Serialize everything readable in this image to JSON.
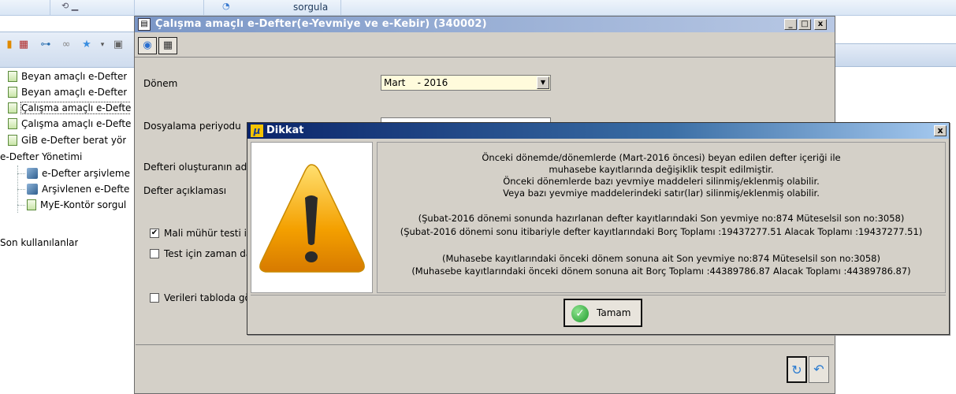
{
  "ribbon": {
    "sorgula_label": "sorgula"
  },
  "tree": {
    "items": [
      {
        "label": "Beyan amaçlı e-Defter"
      },
      {
        "label": "Beyan amaçlı e-Defter"
      },
      {
        "label": "Çalışma amaçlı e-Defte"
      },
      {
        "label": "Çalışma amaçlı e-Defte"
      },
      {
        "label": "GİB e-Defter berat yör"
      },
      {
        "label": "e-Defter Yönetimi"
      },
      {
        "label": "e-Defter arşivleme"
      },
      {
        "label": "Arşivlenen e-Defte"
      },
      {
        "label": "MyE-Kontör sorgul"
      },
      {
        "label": "Son kullanılanlar"
      }
    ]
  },
  "window": {
    "title": "Çalışma amaçlı e-Defter(e-Yevmiye ve e-Kebir) (340002)",
    "minimize": "_",
    "maximize": "□",
    "close": "x",
    "form": {
      "donem_label": "Dönem",
      "donem_value": "Mart    - 2016",
      "periyod_label": "Dosyalama periyodu",
      "olusturan_label": "Defteri oluşturanın ad",
      "aciklama_label": "Defter açıklaması",
      "mali_muhur_label": "Mali mühür testi iç",
      "mali_muhur_checked": "✔",
      "test_zaman_label": "Test için zaman da",
      "verileri_label": "Verileri tabloda gö"
    }
  },
  "dialog": {
    "title": "Dikkat",
    "close": "x",
    "lines": [
      "Önceki dönemde/dönemlerde (Mart-2016 öncesi) beyan edilen defter içeriği ile",
      "muhasebe kayıtlarında değişiklik tespit edilmiştir.",
      "Önceki dönemlerde bazı yevmiye maddeleri silinmiş/eklenmiş olabilir.",
      "Veya bazı yevmiye maddelerindeki satır(lar) silinmiş/eklenmiş olabilir.",
      "(Şubat-2016 dönemi sonunda hazırlanan defter kayıtlarındaki Son yevmiye no:874  Müteselsil son no:3058)",
      "(Şubat-2016 dönemi sonu itibariyle defter kayıtlarındaki Borç Toplamı :19437277.51  Alacak Toplamı :19437277.51)",
      "(Muhasebe kayıtlarındaki önceki dönem sonuna ait Son yevmiye no:874  Müteselsil son no:3058)",
      "(Muhasebe kayıtlarındaki önceki dönem sonuna ait Borç Toplamı :44389786.87  Alacak Toplamı :44389786.87)"
    ],
    "ok_label": "Tamam"
  }
}
